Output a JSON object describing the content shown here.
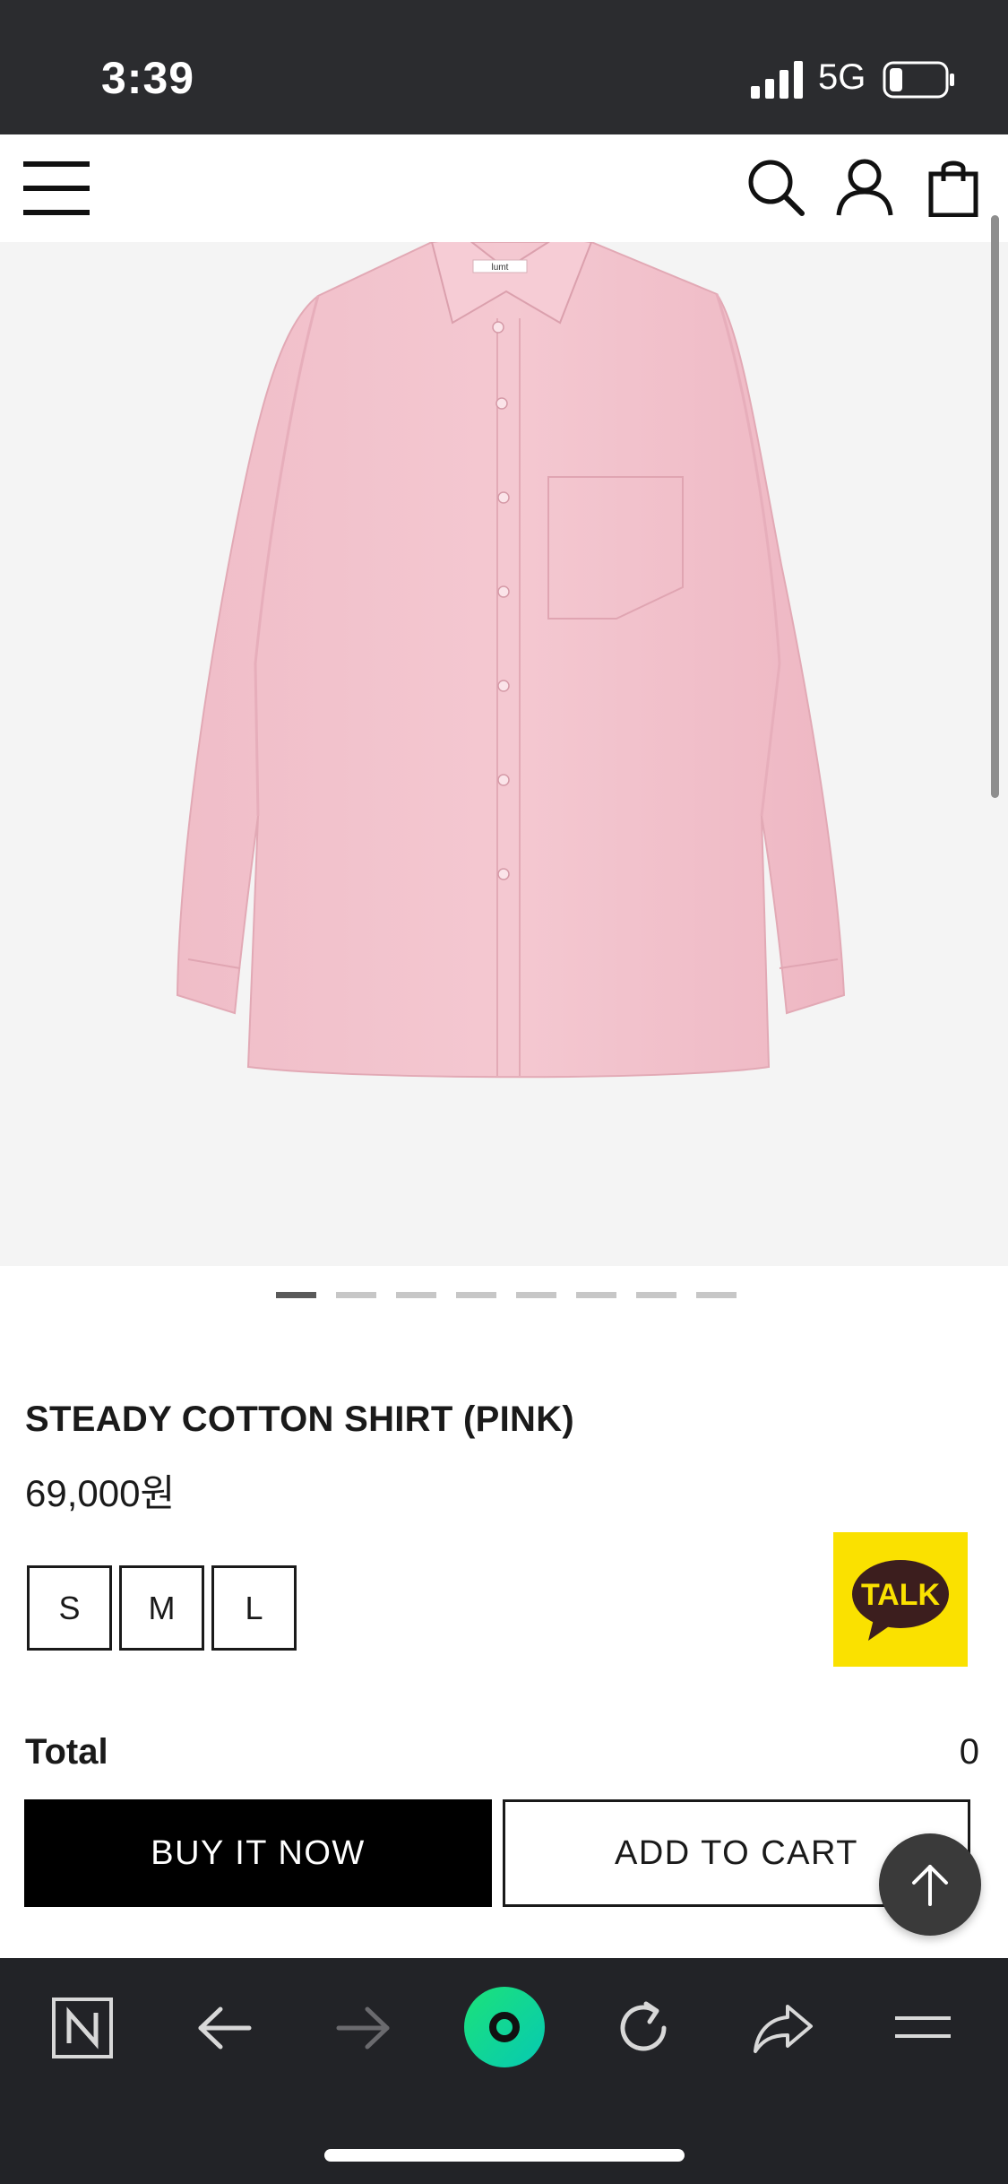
{
  "status_bar": {
    "time": "3:39",
    "network": "5G"
  },
  "product": {
    "title": "STEADY COTTON SHIRT (PINK)",
    "price": "69,000원",
    "label_tag": "lumt",
    "sizes": [
      "S",
      "M",
      "L"
    ],
    "image_count": 8,
    "active_image": 1
  },
  "kakao": {
    "label": "TALK"
  },
  "order": {
    "total_label": "Total",
    "total_value": "0"
  },
  "actions": {
    "buy_label": "BUY IT NOW",
    "cart_label": "ADD TO CART"
  },
  "colors": {
    "kakao_yellow": "#fae100",
    "shirt_pink": "#f2c2cc",
    "toolbar_green": "#10d78f"
  },
  "icons": {
    "header": [
      "menu-icon",
      "search-icon",
      "user-icon",
      "shopping-bag-icon"
    ],
    "toolbar": [
      "naver-n-icon",
      "back-arrow-icon",
      "forward-arrow-icon",
      "green-dot-home-icon",
      "refresh-icon",
      "share-icon",
      "menu-icon"
    ]
  }
}
